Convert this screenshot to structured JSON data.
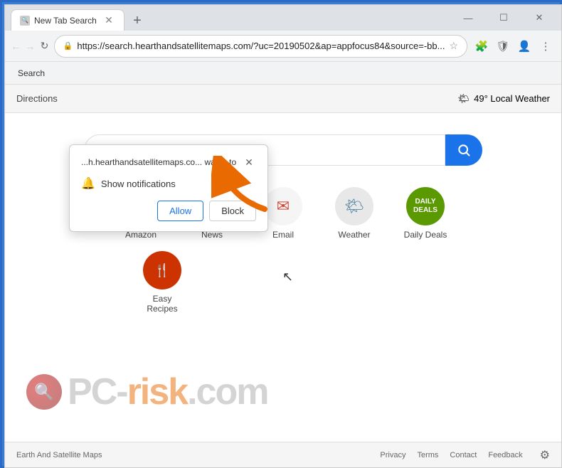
{
  "browser": {
    "tab_title": "New Tab Search",
    "tab_favicon": "🔍",
    "new_tab_icon": "+",
    "window_controls": {
      "minimize": "—",
      "maximize": "☐",
      "close": "✕"
    },
    "url": "https://search.hearthandsatellitemaps.com/?uc=20190502&ap=appfocus84&source=-bb...",
    "url_short": "https://search.hearthandsatellitemaps.com/?uc=20190502&ap=appfocus84&source=-bb...",
    "back_icon": "←",
    "forward_icon": "→",
    "refresh_icon": "↻",
    "home_icon": "⌂",
    "star_icon": "☆",
    "extensions_icon": "🧩",
    "shield_icon": "🛡",
    "account_icon": "👤",
    "menu_icon": "⋮"
  },
  "bookmarks_bar": {
    "item": "Search"
  },
  "top_strip": {
    "directions": "Directions",
    "weather_icon": "🌤",
    "weather": "49° Local Weather"
  },
  "search": {
    "placeholder": "",
    "button_icon": "🔍"
  },
  "quick_links": [
    {
      "label": "Amazon",
      "icon": "a",
      "type": "amazon"
    },
    {
      "label": "News",
      "icon": "N",
      "type": "news"
    },
    {
      "label": "Email",
      "icon": "✉",
      "type": "email"
    },
    {
      "label": "Weather",
      "icon": "🌤",
      "type": "weather"
    },
    {
      "label": "Daily Deals",
      "icon": "DAILY\nDEALS",
      "type": "deals"
    }
  ],
  "quick_links_row2": [
    {
      "label": "Easy Recipes",
      "icon": "🍴",
      "type": "recipes"
    }
  ],
  "bottom_bar": {
    "left_text": "Earth And Satellite Maps",
    "links": [
      "Privacy",
      "Terms",
      "Contact",
      "Feedback"
    ]
  },
  "notification_popup": {
    "site_text": "...h.hearthandsatellitemaps.co...",
    "site_suffix": "wants to",
    "close_icon": "✕",
    "bell_icon": "🔔",
    "notification_text": "Show notifications",
    "allow_label": "Allow",
    "block_label": "Block"
  },
  "watermark": {
    "text_gray": "PC-",
    "text_orange": "risk",
    "text_suffix": ".com"
  }
}
